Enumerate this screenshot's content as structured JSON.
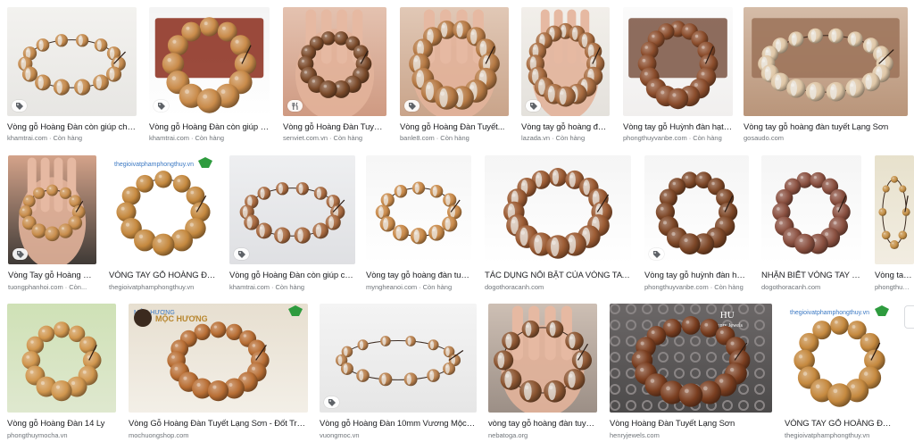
{
  "colors": {
    "wood_light": "#c58b4e",
    "wood_dark": "#6d3e22",
    "text": "#202124",
    "muted": "#70757a",
    "silver": "#e9e6e1"
  },
  "rows": [
    {
      "items": [
        {
          "caption": "Vòng gỗ Hoàng Đàn còn giúp cho ...",
          "source": "khamtrai.com",
          "stock": "Còn hàng",
          "badge": "tag-icon"
        },
        {
          "caption": "Vòng gỗ Hoàng Đàn còn giúp ch...",
          "source": "khamtrai.com",
          "stock": "Còn hàng",
          "badge": "tag-icon"
        },
        {
          "caption": "Vòng gỗ Hoàng Đàn Tuyết L...",
          "source": "senviet.com.vn",
          "stock": "Còn hàng",
          "badge": "restaurant-icon"
        },
        {
          "caption": "Vòng gỗ Hoàng Đàn Tuyết...",
          "source": "banle8.com",
          "stock": "Còn hàng",
          "badge": "tag-icon"
        },
        {
          "caption": "Vòng tay gỗ hoàng đàn ...",
          "source": "lazada.vn",
          "stock": "Còn hàng",
          "badge": "tag-icon"
        },
        {
          "caption": "Vòng tay gỗ Huỳnh đàn hạt tr...",
          "source": "phongthuyvanbe.com",
          "stock": "Còn hàng",
          "badge": ""
        },
        {
          "caption": "Vòng tay gỗ hoàng đàn tuyết Lạng Sơn",
          "source": "gosaudo.com",
          "stock": "",
          "badge": ""
        }
      ]
    },
    {
      "items": [
        {
          "caption": "Vòng Tay gỗ Hoàng Đàn...",
          "source": "tuongphanhoi.com",
          "stock": "Còn...",
          "badge": "tag-icon"
        },
        {
          "caption": "VÒNG TAY GỖ HOÀNG ĐÀN ...",
          "source": "thegioivatphamphongthuy.vn",
          "stock": "",
          "badge": "",
          "logo_text": "thegioivatphamphongthuy.vn"
        },
        {
          "caption": "Vòng gỗ Hoàng Đàn còn giúp cho ...",
          "source": "khamtrai.com",
          "stock": "Còn hàng",
          "badge": "tag-icon"
        },
        {
          "caption": "Vòng tay gỗ hoàng đàn tuyế...",
          "source": "myngheanoi.com",
          "stock": "Còn hàng",
          "badge": ""
        },
        {
          "caption": "TÁC DỤNG NỔI BẬT CỦA VÒNG TAY GỖ ...",
          "source": "dogothoracanh.com",
          "stock": "",
          "badge": ""
        },
        {
          "caption": "Vòng tay gỗ huỳnh đàn hạt t...",
          "source": "phongthuyvanbe.com",
          "stock": "Còn hàng",
          "badge": "tag-icon"
        },
        {
          "caption": "NHẬN BIẾT VÒNG TAY GỖ ...",
          "source": "dogothoracanh.com",
          "stock": "",
          "badge": ""
        },
        {
          "caption": "Vòng tay gỗ",
          "source": "phongthuyo...",
          "stock": "",
          "badge": ""
        }
      ]
    },
    {
      "items": [
        {
          "caption": "Vòng gỗ Hoàng Đàn 14 Ly",
          "source": "phongthuymocha.vn",
          "stock": "",
          "badge": ""
        },
        {
          "caption": "Vòng Gỗ Hoàng Đàn Tuyết Lạng Sơn - Đốt Trúc Đe...",
          "source": "mochuongshop.com",
          "stock": "",
          "badge": "",
          "logo_text": "MỘC HƯƠNG"
        },
        {
          "caption": "Vòng gỗ Hoàng Đàn 10mm Vương Mộc Tử ...",
          "source": "vuongmoc.vn",
          "stock": "",
          "badge": "tag-icon"
        },
        {
          "caption": "vòng tay gỗ hoàng đàn tuyết ...",
          "source": "nebatoga.org",
          "stock": "",
          "badge": ""
        },
        {
          "caption": "Vòng Hoàng Đàn Tuyết Lạng Sơn",
          "source": "henryjewels.com",
          "stock": "",
          "badge": "",
          "logo_text": "HU",
          "logo_sub": "Henry Jewels"
        },
        {
          "caption": "VÒNG TAY GỖ HOÀNG ĐÀN ...",
          "source": "thegioivatphamphongthuy.vn",
          "stock": "",
          "badge": "",
          "logo_text": "thegioivatphamphongthuy.vn"
        }
      ]
    }
  ]
}
